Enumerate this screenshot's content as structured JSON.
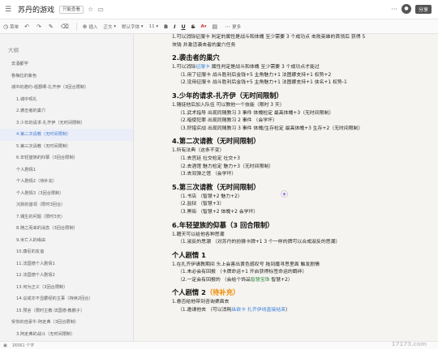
{
  "header": {
    "menu_icon": "hamburger-icon",
    "title": "苏丹的游戏",
    "permission": "只能查看",
    "share_label": "分享",
    "user_initial": "",
    "more": "···"
  },
  "toolbar": {
    "items": [
      "菜单",
      "插入",
      "正文",
      "更多"
    ],
    "font": "默认字体",
    "font_size": "11",
    "text_color": "#c33333"
  },
  "outline": {
    "title": "大纲",
    "items": [
      {
        "label": "去酒都学",
        "level": 1
      },
      {
        "label": "魯梅拉的紫色",
        "level": 1
      },
      {
        "label": "城中的邀约-祖郡卿-扎齐伊（3回合限制）",
        "level": 1
      },
      {
        "label": "1.城中现礼",
        "level": 2
      },
      {
        "label": "2.袭击者的巢穴",
        "level": 2
      },
      {
        "label": "3.少年的请求-扎齐伊（无时间限制）",
        "level": 2
      },
      {
        "label": "4.第二次请教（无时间限制）",
        "level": 2,
        "active": true
      },
      {
        "label": "5.第三次请教（无时间限制）",
        "level": 2
      },
      {
        "label": "6.年轻望族的仰慕（3回合限制）",
        "level": 2
      },
      {
        "label": "个人剧情1",
        "level": 2
      },
      {
        "label": "个人剧情2（待补充）",
        "level": 2
      },
      {
        "label": "个人剧情3（3回合限制）",
        "level": 2
      },
      {
        "label": "沉默的首领（限时3回合）",
        "level": 2
      },
      {
        "label": "7.偶生的问题（限时3天）",
        "level": 2
      },
      {
        "label": "8.随之而来的消息（3回合限制）",
        "level": 2
      },
      {
        "label": "9.米亡人的缘由",
        "level": 2
      },
      {
        "label": "10.康尼的友谊",
        "level": 2
      },
      {
        "label": "11.法国德个人剧情1",
        "level": 2
      },
      {
        "label": "12.法国德个人剧情2",
        "level": 2
      },
      {
        "label": "13.何为正义（3回合限制）",
        "level": 2
      },
      {
        "label": "14.议戒亦不显麝经的主事（持续2回合）",
        "level": 2
      },
      {
        "label": "15.预言（限时主教·法国德·教鹏子）",
        "level": 2
      },
      {
        "label": "受你的自豪牛-阿走弗（3回合限制）",
        "level": 1
      },
      {
        "label": "3.阿走弗的战斗（无时间限制）",
        "level": 2
      },
      {
        "label": "4.不期的冲突（3回合限制）",
        "level": 2
      }
    ]
  },
  "document": {
    "top_line1": "1.可以消除征服卡 判定的属性是战斗和体魄 至少需要 3 个成功点 击败英雄的首领后 获得 5",
    "top_line2": "块钱 并激活袭击者的巢穴任务",
    "sec2_title": "2.袭击者的巢穴",
    "sec2_intro_a": "1.可以消除",
    "sec2_intro_link": "征服卡",
    "sec2_intro_b": " 属性判定是战斗和体魄 至少需要 3 个成功点才能过",
    "sec2_l1": "（1.用了征服卡 战斗胜利后金钱+5 主角魅力+1 法图娜支持+1 权势+2",
    "sec2_l2": "（2.没用征服卡 战斗胜利后金钱+5 主角魅力+1 法图娜支持+1 侠名+1 权势-1",
    "sec3_title": "3.少年的请求-扎齐伊（无时间限制）",
    "sec3_intro": "1.随徒他后加入队伍 可以教他一个技能（限时 3 天）",
    "sec3_l1": "（1.武术指导 出现同随教习 3 事件 体魄检定 最高体魄+3（无时间限制）",
    "sec3_l2": "（2.暗使犯罪 出现同随教习 2 事件 （会学坏）",
    "sec3_l3": "（3.狩猎实战 出现同随教习 3 事件 体魄/生存检定 最高体魄+3 生存+2（无时间限制）",
    "sec4_title": "4.第二次请教（无时间限制）",
    "sec4_intro": "1.所有法典（这条不变）",
    "sec4_l1": "（1.去宫廷 社交检定 社交+3",
    "sec4_l2": "（2.去酒馆 魅力检定 魅力+3（无时间限制）",
    "sec4_l3": "（3.去双弹之馆 （会学坏）",
    "sec5_title": "5.第三次请教（无时间限制）",
    "sec5_l1": "（1.书店 （智慧+2 魅力+2）",
    "sec5_l2": "（2.监狱 （智慧+3）",
    "sec5_l3": "（3.黑街 （智慧+2 体魄+2 会学坏）",
    "sec6_title": "6.年轻望族的仰慕（3 回合限制）",
    "sec6_intro": "1.藉天可以给他各种思潮",
    "sec6_l1": "（1.淑反的思潮 （对苏丹的扮猜卡牌+1 3 个一样的牌可以合成淑反的思潮）",
    "p1_title": "个人剧情 1",
    "p1_intro": "1.在扎齐伊请教期间 头上会害出黄色感叹号 拖到魔寻思里面 触发剧情",
    "p1_l1": "（1.未必会有回报 （卡牌命运+1 开启获得标签命运的羁绊）",
    "p1_l2_a": "（2.一定会有回报的 （会给个饰品",
    "p1_l2_link": "智慧宝珠",
    "p1_l2_b": " 智慧+2）",
    "p2_title_a": "个人剧情 2",
    "p2_title_b": "（待补充）",
    "p2_intro": "1.悬否给他带到咨询渠面去",
    "p2_l1_a": "（1.邀请他去 （可以消耗",
    "p2_l1_link": "纵欲卡 扎齐伊线直接结束",
    "p2_l1_b": "）"
  },
  "status": {
    "word_count": "16561 个字",
    "zoom": "100%"
  },
  "watermark": "17173.com"
}
